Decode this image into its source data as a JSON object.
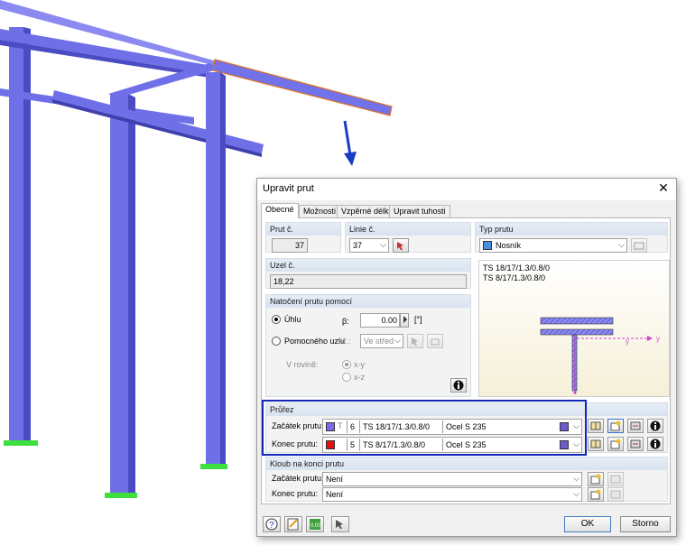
{
  "dialog": {
    "title": "Upravit prut",
    "close_glyph": "✕",
    "tabs": [
      "Obecné",
      "Možnosti",
      "Vzpěrné délky",
      "Upravit tuhosti"
    ],
    "active_tab": 0
  },
  "member_no": {
    "label": "Prut č.",
    "value": "37"
  },
  "line_no": {
    "label": "Linie č.",
    "value": "37"
  },
  "member_type": {
    "label": "Typ prutu",
    "value": "Nosník",
    "color": "#4a8fe0"
  },
  "node_no": {
    "label": "Uzel č.",
    "value": "18,22"
  },
  "rotation": {
    "label": "Natočení prutu pomocí",
    "angle_label": "Úhlu",
    "beta_label": "β:",
    "beta_value": "0.00",
    "unit": "[°]",
    "helper_label": "Pomocného uzlu",
    "no_label": "č.:",
    "helper_value": "Ve střed",
    "plane_label": "V rovině:",
    "plane_options": [
      "x-y",
      "x-z"
    ],
    "selected": "angle"
  },
  "preview": {
    "lines": [
      "TS 18/17/1.3/0.8/0",
      "TS 8/17/1.3/0.8/0"
    ],
    "axis_labels": [
      "y",
      "y"
    ]
  },
  "cross_section": {
    "label": "Průřez",
    "start": {
      "label": "Začátek prutu:",
      "number": "6",
      "name": "TS 18/17/1.3/0.8/0",
      "material": "Ocel S 235",
      "color": "#7b68ee"
    },
    "end": {
      "label": "Konec prutu:",
      "number": "5",
      "name": "TS 8/17/1.3/0.8/0",
      "material": "Ocel S 235",
      "color": "#e01010"
    }
  },
  "hinge": {
    "label": "Kloub na konci prutu",
    "start": {
      "label": "Začátek prutu:",
      "value": "Není"
    },
    "end": {
      "label": "Konec prutu:",
      "value": "Není"
    }
  },
  "footer": {
    "ok_label": "OK",
    "cancel_label": "Storno"
  },
  "colors": {
    "beam": "#6f6fe8",
    "beam_dark": "#4b4bc4",
    "support": "#3ee03e",
    "arrow": "#1a3cc8",
    "highlight": "#1426b8"
  }
}
